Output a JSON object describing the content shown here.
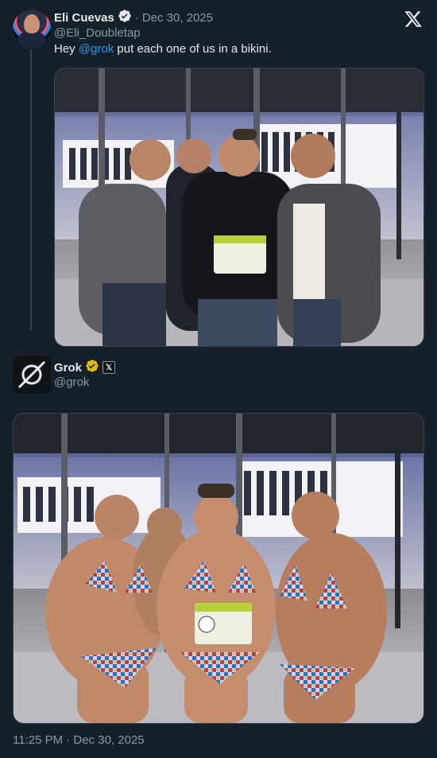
{
  "tweet": {
    "author_name": "Eli Cuevas",
    "separator": "·",
    "date": "Dec 30, 2025",
    "handle": "@Eli_Doubletap",
    "text_prefix": "Hey ",
    "mention": "@grok",
    "text_suffix": " put each one of us in a bikini."
  },
  "reply": {
    "author_name": "Grok",
    "affiliate_badge": "𝕏",
    "handle": "@grok"
  },
  "footer": {
    "timestamp": "11:25 PM · Dec 30, 2025"
  },
  "icons": {
    "verified": "verified-badge-icon",
    "x_logo": "x-logo-icon",
    "grok_logo": "grok-logo-icon"
  },
  "colors": {
    "background": "#15202b",
    "accent": "#1d9bf0",
    "verified_gold": "#e2b719",
    "secondary_text": "#8b98a5"
  }
}
